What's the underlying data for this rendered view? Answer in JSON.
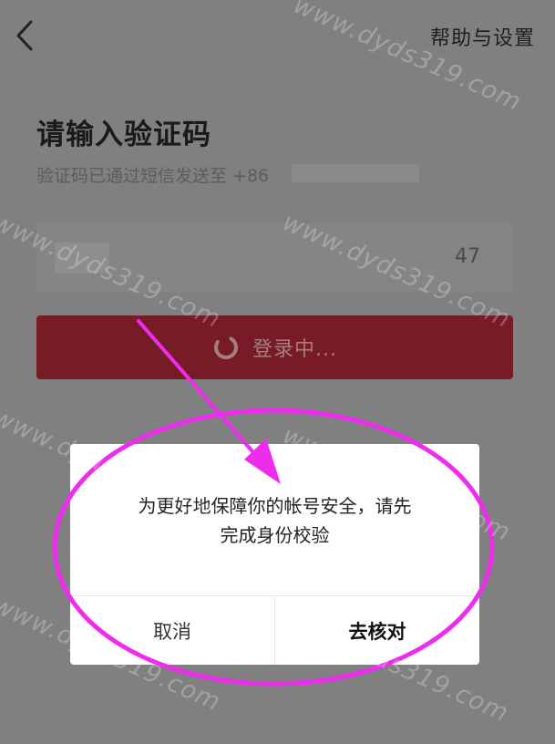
{
  "header": {
    "back_icon": "chevron-left-icon",
    "help_label": "帮助与设置"
  },
  "main": {
    "title": "请输入验证码",
    "subtitle": "验证码已通过短信发送至 +86",
    "countdown": "47",
    "login_label": "登录中...",
    "spinner_icon": "loading-spinner-icon"
  },
  "dialog": {
    "message_line1": "为更好地保障你的帐号安全，请先",
    "message_line2": "完成身份校验",
    "cancel_label": "取消",
    "confirm_label": "去核对"
  },
  "watermark": {
    "text": "www.dyds319.com"
  },
  "colors": {
    "page_dim": "#808080",
    "login_button": "#771c26",
    "annotation_magenta": "#ee2cee",
    "dialog_bg": "#ffffff"
  }
}
